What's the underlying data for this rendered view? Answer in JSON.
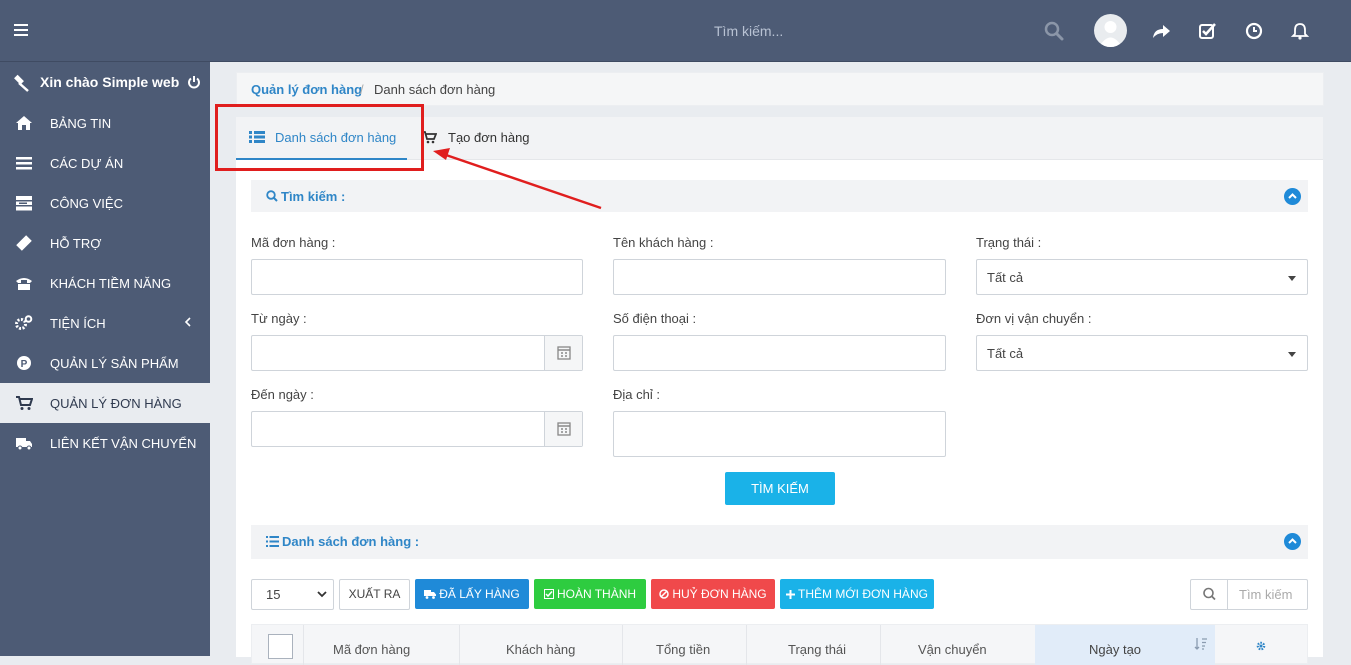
{
  "topbar": {
    "search_placeholder": "Tìm kiếm..."
  },
  "sidebar": {
    "greeting": "Xin chào Simple web",
    "items": [
      {
        "label": "BẢNG TIN",
        "icon": "home-icon"
      },
      {
        "label": "CÁC DỰ ÁN",
        "icon": "bars-icon"
      },
      {
        "label": "CÔNG VIỆC",
        "icon": "tasks-icon"
      },
      {
        "label": "HỖ TRỢ",
        "icon": "ticket-icon"
      },
      {
        "label": "KHÁCH TIỀM NĂNG",
        "icon": "phone-icon"
      },
      {
        "label": "TIỆN ÍCH",
        "icon": "cogs-icon"
      },
      {
        "label": "QUẢN LÝ SẢN PHẨM",
        "icon": "product-icon"
      },
      {
        "label": "QUẢN LÝ ĐƠN HÀNG",
        "icon": "cart-icon"
      },
      {
        "label": "LIÊN KẾT VẬN CHUYỂN",
        "icon": "truck-icon"
      }
    ]
  },
  "breadcrumb": {
    "parent": "Quản lý đơn hàng",
    "separator": "/",
    "current": "Danh sách đơn hàng"
  },
  "tabs": {
    "list": "Danh sách đơn hàng",
    "create": "Tạo đơn hàng"
  },
  "search": {
    "title": "Tìm kiếm :",
    "order_code_label": "Mã đơn hàng :",
    "customer_name_label": "Tên khách hàng :",
    "status_label": "Trạng thái :",
    "status_value": "Tất cả",
    "from_date_label": "Từ ngày :",
    "phone_label": "Số điện thoại :",
    "shipper_label": "Đơn vị vận chuyển :",
    "shipper_value": "Tất cả",
    "to_date_label": "Đến ngày :",
    "address_label": "Địa chỉ :",
    "submit": "TÌM KIẾM"
  },
  "list": {
    "title": "Danh sách đơn hàng :",
    "page_size": "15",
    "export": "XUẤT RA",
    "picked": "ĐÃ LẤY HÀNG",
    "done": "HOÀN THÀNH",
    "cancel": "HUỶ ĐƠN HÀNG",
    "add": "THÊM MỚI ĐƠN HÀNG",
    "search_placeholder": "Tìm kiếm",
    "columns": [
      "Mã đơn hàng",
      "Khách hàng",
      "Tổng tiền",
      "Trạng thái",
      "Vận chuyển",
      "Ngày tạo"
    ]
  },
  "colors": {
    "primary": "#2f86c7",
    "sidebar": "#4d5b75",
    "picked": "#1f8ad8",
    "done": "#2ecc40",
    "cancel": "#f0494b",
    "add": "#1ab2e8",
    "annotation": "#e01e1e"
  }
}
